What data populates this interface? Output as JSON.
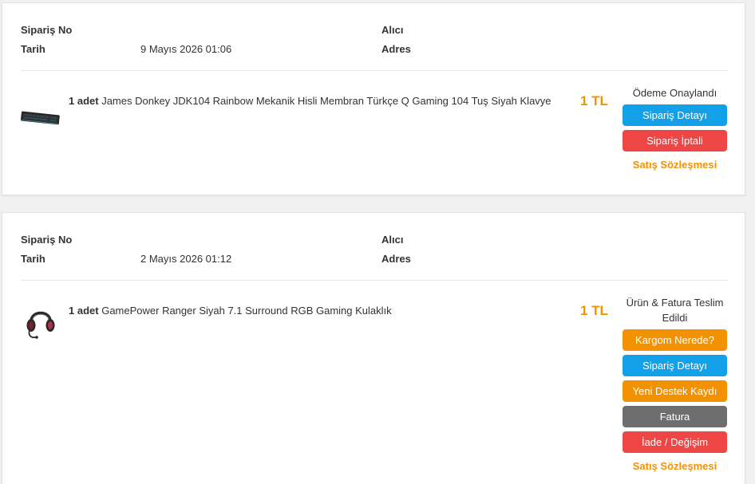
{
  "orders": [
    {
      "order_no_label": "Sipariş No",
      "date_label": "Tarih",
      "date_value": "9 Mayıs 2026 01:06",
      "recipient_label": "Alıcı",
      "address_label": "Adres",
      "product": {
        "qty": "1 adet",
        "name": "James Donkey JDK104 Rainbow Mekanik Hisli Membran Türkçe Q Gaming 104 Tuş Siyah Klavye",
        "price": "1 TL",
        "thumb_icon": "keyboard-icon"
      },
      "status": "Ödeme Onaylandı",
      "buttons": [
        "Sipariş Detayı",
        "Sipariş İptali"
      ],
      "contract_link": "Satış Sözleşmesi"
    },
    {
      "order_no_label": "Sipariş No",
      "date_label": "Tarih",
      "date_value": "2 Mayıs 2026 01:12",
      "recipient_label": "Alıcı",
      "address_label": "Adres",
      "product": {
        "qty": "1 adet",
        "name": "GamePower Ranger Siyah 7.1 Surround RGB Gaming Kulaklık",
        "price": "1 TL",
        "thumb_icon": "headset-icon"
      },
      "status": "Ürün & Fatura Teslim Edildi",
      "buttons": [
        "Kargom Nerede?",
        "Sipariş Detayı",
        "Yeni Destek Kaydı",
        "Fatura",
        "İade / Değişim"
      ],
      "contract_link": "Satış Sözleşmesi"
    }
  ],
  "colors": {
    "accent_orange": "#f39200",
    "blue": "#12a0e8",
    "red": "#ee4545",
    "gray": "#6e6e6e"
  }
}
